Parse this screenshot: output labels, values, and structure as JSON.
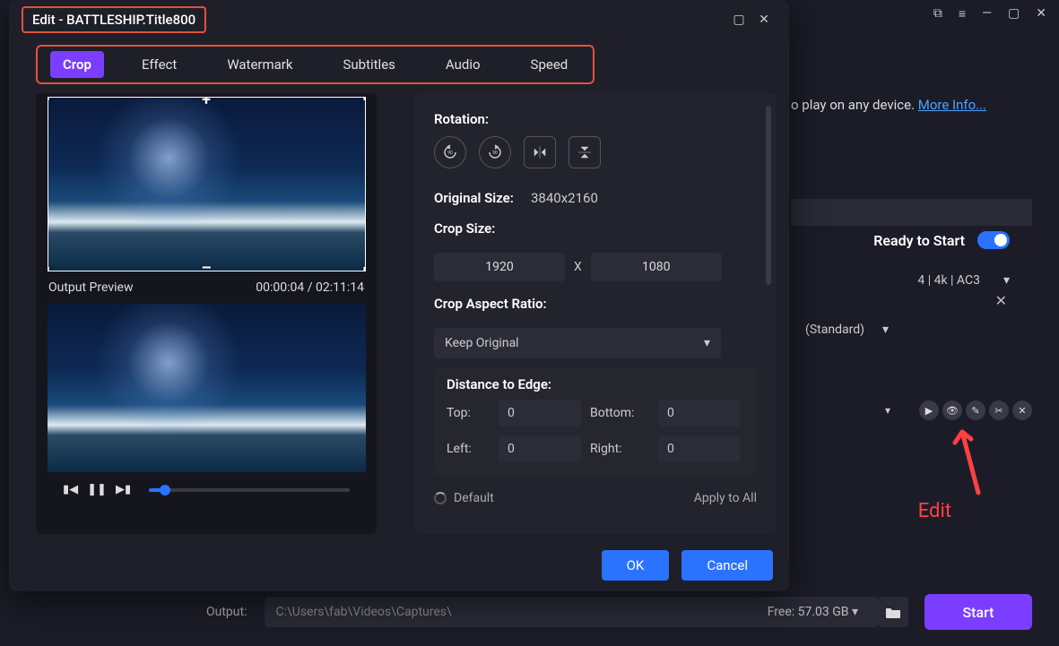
{
  "app_top": {
    "menu_icon": "≡",
    "minimize": "—",
    "maximize": "▢",
    "close": "✕",
    "extra": "⧉"
  },
  "background": {
    "info_text": "o play on any device. ",
    "more_info": "More Info...",
    "ready_label": "Ready to Start",
    "format_line": "4 | 4k | AC3",
    "profile_line": "(Standard)",
    "edit_callout": "Edit"
  },
  "footer": {
    "output_label": "Output:",
    "output_path": "C:\\Users\\fab\\Videos\\Captures\\",
    "free_label": "Free: 57.03 GB",
    "start_label": "Start"
  },
  "modal": {
    "title": "Edit - BATTLESHIP.Title800",
    "tabs": {
      "crop": "Crop",
      "effect": "Effect",
      "watermark": "Watermark",
      "subtitles": "Subtitles",
      "audio": "Audio",
      "speed": "Speed"
    },
    "preview": {
      "output_label": "Output Preview",
      "time": "00:00:04 / 02:11:14",
      "handle_plus": "+",
      "handle_minus": "–"
    },
    "crop": {
      "rotation_label": "Rotation:",
      "original_size_label": "Original Size:",
      "original_size_value": "3840x2160",
      "crop_size_label": "Crop Size:",
      "crop_w": "1920",
      "crop_h": "1080",
      "x_sep": "X",
      "aspect_label": "Crop Aspect Ratio:",
      "aspect_value": "Keep Original",
      "dist_label": "Distance to Edge:",
      "top_label": "Top:",
      "bottom_label": "Bottom:",
      "left_label": "Left:",
      "right_label": "Right:",
      "top_v": "0",
      "bottom_v": "0",
      "left_v": "0",
      "right_v": "0",
      "default_label": "Default",
      "apply_label": "Apply to All"
    },
    "buttons": {
      "ok": "OK",
      "cancel": "Cancel"
    }
  }
}
